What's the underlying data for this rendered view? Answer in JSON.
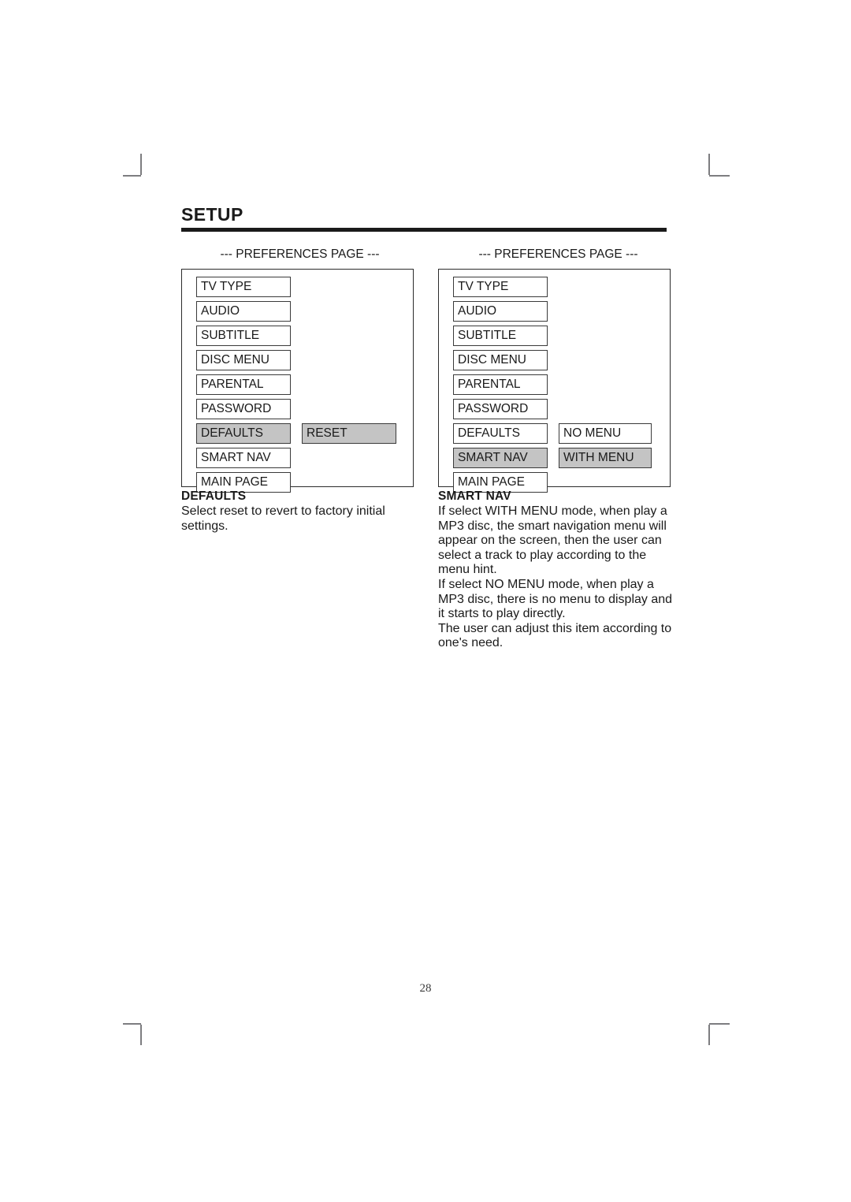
{
  "page": {
    "title": "SETUP",
    "folio": "28"
  },
  "panels": [
    {
      "caption": "--- PREFERENCES PAGE ---",
      "menu_items": [
        {
          "label": "TV TYPE",
          "selected": false
        },
        {
          "label": "AUDIO",
          "selected": false
        },
        {
          "label": "SUBTITLE",
          "selected": false
        },
        {
          "label": "DISC MENU",
          "selected": false
        },
        {
          "label": "PARENTAL",
          "selected": false
        },
        {
          "label": "PASSWORD",
          "selected": false
        },
        {
          "label": "DEFAULTS",
          "selected": true
        },
        {
          "label": "SMART NAV",
          "selected": false
        },
        {
          "label": "MAIN PAGE",
          "selected": false
        }
      ],
      "options": [
        {
          "label": "RESET",
          "selected": true,
          "row": 7
        }
      ]
    },
    {
      "caption": "--- PREFERENCES PAGE ---",
      "menu_items": [
        {
          "label": "TV TYPE",
          "selected": false
        },
        {
          "label": "AUDIO",
          "selected": false
        },
        {
          "label": "SUBTITLE",
          "selected": false
        },
        {
          "label": "DISC MENU",
          "selected": false
        },
        {
          "label": "PARENTAL",
          "selected": false
        },
        {
          "label": "PASSWORD",
          "selected": false
        },
        {
          "label": "DEFAULTS",
          "selected": false
        },
        {
          "label": "SMART NAV",
          "selected": true
        },
        {
          "label": "MAIN PAGE",
          "selected": false
        }
      ],
      "options": [
        {
          "label": "NO MENU",
          "selected": false,
          "row": 7
        },
        {
          "label": "WITH MENU",
          "selected": true,
          "row": 8
        }
      ]
    }
  ],
  "descriptions": [
    {
      "heading": "DEFAULTS",
      "body": "Select reset to revert to factory initial settings."
    },
    {
      "heading": "SMART NAV",
      "body": "If select WITH MENU mode, when play a MP3 disc, the smart navigation menu will appear on the screen, then the user can select a track to play according to the menu hint.\nIf select NO MENU mode, when play a MP3 disc, there is no menu to display and it starts to play directly.\nThe user can adjust this item according to one's need."
    }
  ],
  "colors": {
    "highlight": "#c4c4c4",
    "rule": "#1a1a1a",
    "box_border": "#3a3a3a",
    "crop_mark": "#7d7d80"
  }
}
